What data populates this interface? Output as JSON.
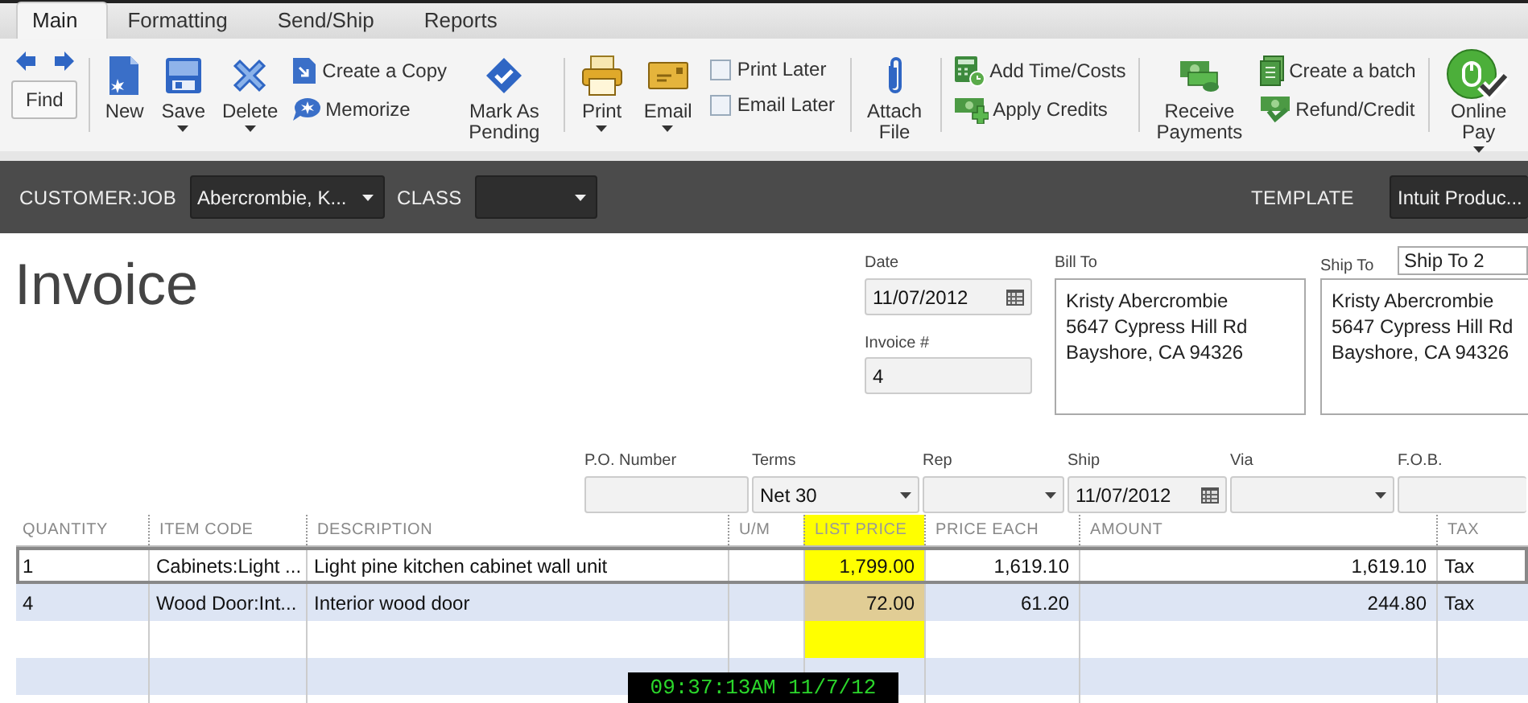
{
  "tabs": [
    {
      "label": "Main",
      "selected": true
    },
    {
      "label": "Formatting",
      "selected": false
    },
    {
      "label": "Send/Ship",
      "selected": false
    },
    {
      "label": "Reports",
      "selected": false
    }
  ],
  "toolbar": {
    "groups": [
      {
        "kind": "navigation",
        "button": "Find"
      },
      {
        "kind": "actions",
        "items": [
          {
            "kind": "large",
            "label": "New",
            "dropdown": false
          },
          {
            "kind": "large",
            "label": "Save",
            "dropdown": true
          },
          {
            "kind": "large",
            "label": "Delete",
            "dropdown": true
          },
          {
            "kind": "small",
            "label": "Create a Copy"
          },
          {
            "kind": "small",
            "label": "Memorize"
          },
          {
            "kind": "large",
            "label": "Mark As Pending",
            "dropdown": false
          }
        ]
      },
      {
        "kind": "actions",
        "items": [
          {
            "kind": "large",
            "label": "Print",
            "dropdown": true
          },
          {
            "kind": "large",
            "label": "Email",
            "dropdown": true
          },
          {
            "kind": "checkbox",
            "label": "Print Later",
            "checked": false
          },
          {
            "kind": "checkbox",
            "label": "Email Later",
            "checked": false
          }
        ]
      },
      {
        "kind": "actions",
        "items": [
          {
            "kind": "large",
            "label": "Attach File",
            "dropdown": false
          }
        ]
      },
      {
        "kind": "actions",
        "items": [
          {
            "kind": "small",
            "label": "Add Time/Costs"
          },
          {
            "kind": "small",
            "label": "Apply Credits"
          }
        ]
      },
      {
        "kind": "actions",
        "items": [
          {
            "kind": "large",
            "label": "Receive Payments",
            "dropdown": false
          },
          {
            "kind": "small",
            "label": "Create a batch"
          },
          {
            "kind": "small",
            "label": "Refund/Credit"
          }
        ]
      },
      {
        "kind": "actions",
        "items": [
          {
            "kind": "large",
            "label": "Online Pay",
            "dropdown": true
          }
        ]
      }
    ]
  },
  "header_bar": {
    "customer_job": {
      "label": "CUSTOMER:JOB",
      "value": "Abercrombie, K..."
    },
    "class": {
      "label": "CLASS"
    },
    "template": {
      "label": "TEMPLATE",
      "value": "Intuit Produc..."
    }
  },
  "form": {
    "title": "Invoice",
    "date": {
      "label": "Date",
      "value": "11/07/2012"
    },
    "invoice_number": {
      "label": "Invoice #",
      "value": "4"
    },
    "bill_to": {
      "label": "Bill To",
      "lines": [
        "Kristy Abercrombie",
        "5647 Cypress Hill Rd",
        "Bayshore, CA 94326"
      ]
    },
    "ship_to": {
      "label": "Ship To",
      "selector": "Ship To 2",
      "lines": [
        "Kristy Abercrombie",
        "5647 Cypress Hill Rd",
        "Bayshore, CA 94326"
      ]
    },
    "fields": [
      {
        "kind": "text",
        "label": "P.O. Number"
      },
      {
        "kind": "dropdown",
        "label": "Terms",
        "value": "Net 30"
      },
      {
        "kind": "dropdown",
        "label": "Rep"
      },
      {
        "kind": "date",
        "label": "Ship",
        "value": "11/07/2012"
      },
      {
        "kind": "dropdown",
        "label": "Via"
      },
      {
        "kind": "text",
        "label": "F.O.B."
      }
    ]
  },
  "table": {
    "columns": [
      {
        "label": "QUANTITY",
        "highlighted": false
      },
      {
        "label": "ITEM CODE",
        "highlighted": false
      },
      {
        "label": "DESCRIPTION",
        "highlighted": false
      },
      {
        "label": "U/M",
        "highlighted": false
      },
      {
        "label": "LIST PRICE",
        "highlighted": true
      },
      {
        "label": "PRICE EACH",
        "highlighted": false
      },
      {
        "label": "AMOUNT",
        "highlighted": false
      },
      {
        "label": "TAX",
        "highlighted": false
      }
    ],
    "rows": [
      {
        "selected": true,
        "cells": [
          "1",
          "Cabinets:Light ...",
          "Light pine kitchen cabinet wall unit",
          "",
          "1,799.00",
          "1,619.10",
          "1,619.10",
          "Tax"
        ]
      },
      {
        "selected": false,
        "cells": [
          "4",
          "Wood Door:Int...",
          "Interior wood door",
          "",
          "72.00",
          "61.20",
          "244.80",
          "Tax"
        ]
      }
    ]
  },
  "clock": "09:37:13AM 11/7/12"
}
